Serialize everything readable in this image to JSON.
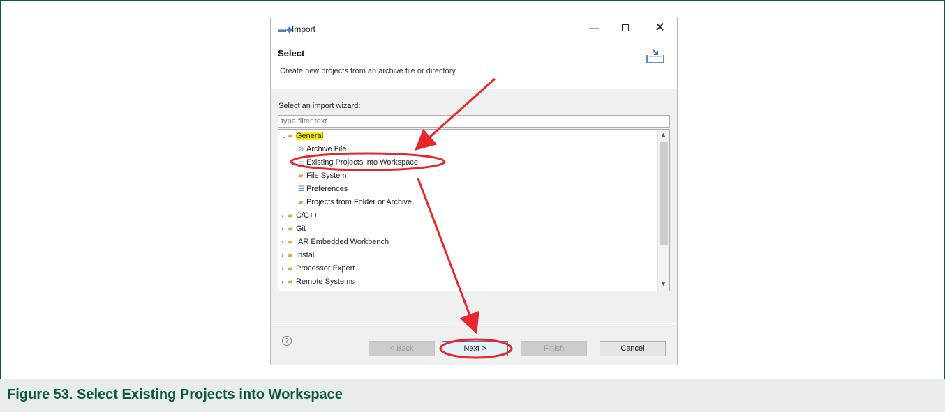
{
  "dialog": {
    "title": "Import",
    "minimize_glyph": "—",
    "close_glyph": "✕",
    "section_title": "Select",
    "section_description": "Create new projects from an archive file or directory.",
    "wizard_label": "Select an import wizard:",
    "filter_placeholder": "type filter text",
    "tree": [
      {
        "label": "General",
        "icon": "folder-open-icon",
        "expanded": true,
        "highlighted": true
      },
      {
        "label": "Archive File",
        "icon": "archive-file-icon"
      },
      {
        "label": "Existing Projects into Workspace",
        "icon": "projects-icon",
        "circled": true
      },
      {
        "label": "File System",
        "icon": "folder-icon"
      },
      {
        "label": "Preferences",
        "icon": "preferences-icon"
      },
      {
        "label": "Projects from Folder or Archive",
        "icon": "folder-icon"
      },
      {
        "label": "C/C++",
        "icon": "folder-icon",
        "expanded": false
      },
      {
        "label": "Git",
        "icon": "folder-icon",
        "expanded": false
      },
      {
        "label": "IAR Embedded Workbench",
        "icon": "folder-icon",
        "expanded": false
      },
      {
        "label": "Install",
        "icon": "folder-icon",
        "expanded": false
      },
      {
        "label": "Processor Expert",
        "icon": "folder-icon",
        "expanded": false
      },
      {
        "label": "Remote Systems",
        "icon": "folder-icon",
        "expanded": false
      }
    ],
    "help_glyph": "?",
    "buttons": {
      "back": "< Back",
      "next": "Next >",
      "finish": "Finish",
      "cancel": "Cancel"
    }
  },
  "caption": "Figure 53.  Select Existing Projects into Workspace",
  "colors": {
    "annotation_red": "#e8262b",
    "highlight_yellow": "#fff200",
    "caption_green": "#0b5a3f"
  }
}
